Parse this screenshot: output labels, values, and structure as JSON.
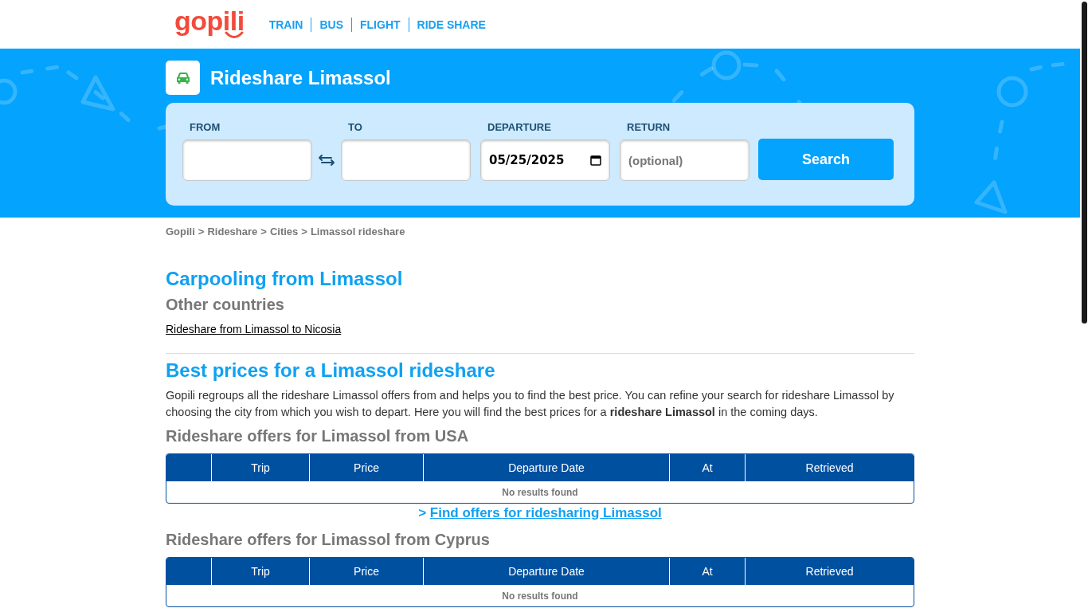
{
  "header": {
    "logo": "gopili",
    "nav": [
      "TRAIN",
      "BUS",
      "FLIGHT",
      "RIDE SHARE"
    ]
  },
  "hero": {
    "title": "Rideshare Limassol",
    "form": {
      "fields": [
        {
          "kind": "text",
          "label": "FROM"
        },
        {
          "kind": "text",
          "label": "TO"
        },
        {
          "kind": "date",
          "label": "DEPARTURE",
          "value": "05/25/2025"
        },
        {
          "kind": "text",
          "label": "RETURN",
          "placeholder": "(optional)"
        }
      ],
      "button": "Search"
    }
  },
  "breadcrumb": {
    "separator": ">",
    "items": [
      "Gopili",
      "Rideshare",
      "Cities",
      "Limassol rideshare"
    ]
  },
  "carpooling": {
    "title": "Carpooling from Limassol",
    "subtitle": "Other countries",
    "links": [
      "Rideshare from Limassol to Nicosia"
    ]
  },
  "best_prices": {
    "title": "Best prices for a Limassol rideshare",
    "text": "Gopili regroups all the rideshare Limassol offers from and helps you to find the best price. You can refine your search for rideshare Limassol by choosing the city from which you wish to depart. Here you will find the best prices for a **rideshare Limassol** in the coming days.",
    "sections": [
      {
        "title": "Rideshare offers for Limassol from USA",
        "table": {
          "columns": [
            {
              "kind": "blank"
            },
            {
              "kind": "label",
              "label": "Trip"
            },
            {
              "kind": "label",
              "label": "Price"
            },
            {
              "kind": "label",
              "label": "Departure Date"
            },
            {
              "kind": "label",
              "label": "At"
            },
            {
              "kind": "label",
              "label": "Retrieved"
            }
          ],
          "empty_message": "No results found"
        },
        "link": {
          "prefix": ">",
          "label": "Find offers for ridesharing Limassol"
        }
      },
      {
        "title": "Rideshare offers for Limassol from Cyprus",
        "table": {
          "columns": [
            {
              "kind": "blank"
            },
            {
              "kind": "label",
              "label": "Trip"
            },
            {
              "kind": "label",
              "label": "Price"
            },
            {
              "kind": "label",
              "label": "Departure Date"
            },
            {
              "kind": "label",
              "label": "At"
            },
            {
              "kind": "label",
              "label": "Retrieved"
            }
          ],
          "empty_message": "No results found"
        }
      }
    ]
  }
}
